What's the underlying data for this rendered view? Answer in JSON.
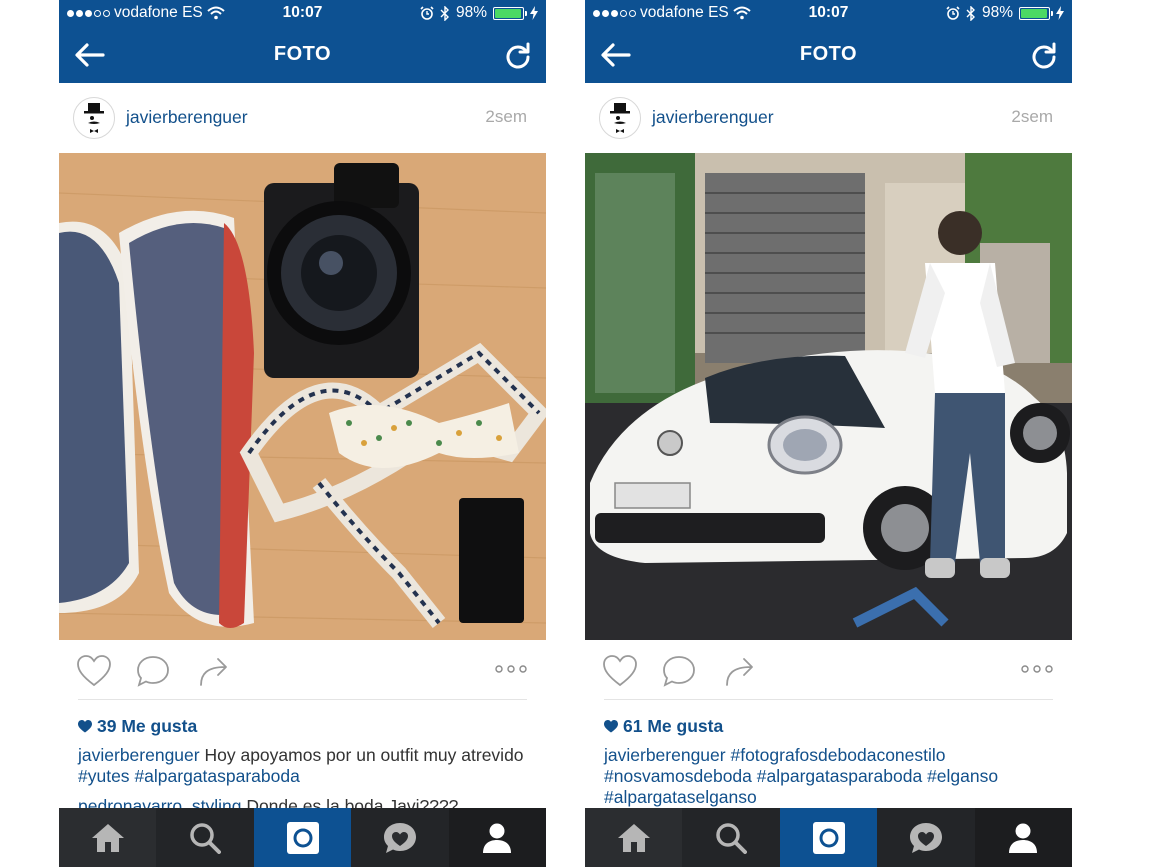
{
  "screens": [
    {
      "status": {
        "carrier": "vodafone ES",
        "time": "10:07",
        "battery": "98%"
      },
      "nav": {
        "title": "FOTO"
      },
      "post": {
        "username": "javierberenguer",
        "time_ago": "2sem",
        "likes": "39 Me gusta",
        "caption": {
          "user": "javierberenguer",
          "text": "Hoy apoyamos por un outfit muy atrevido",
          "tags": [
            "#yutes",
            "#alpargatasparaboda"
          ]
        },
        "comment": {
          "user": "pedronavarro_styling",
          "text": "Donde es la boda Javi????"
        }
      }
    },
    {
      "status": {
        "carrier": "vodafone ES",
        "time": "10:07",
        "battery": "98%"
      },
      "nav": {
        "title": "FOTO"
      },
      "post": {
        "username": "javierberenguer",
        "time_ago": "2sem",
        "likes": "61 Me gusta",
        "caption": {
          "user": "javierberenguer",
          "tags": [
            "#fotografosdebodaconestilo",
            "#nosvamosdeboda",
            "#alpargatasparaboda",
            "#elganso",
            "#alpargataselganso"
          ]
        }
      }
    }
  ],
  "icons": {
    "signal": "signal-dots-icon",
    "wifi": "wifi-icon",
    "alarm": "alarm-icon",
    "bluetooth": "bluetooth-icon",
    "battery": "battery-icon",
    "back": "back-arrow-icon",
    "refresh": "refresh-icon",
    "like": "heart-icon",
    "comment": "comment-bubble-icon",
    "share": "share-arrow-icon",
    "more": "more-dots-icon",
    "home": "home-icon",
    "explore": "search-icon",
    "camera": "camera-icon",
    "activity": "activity-heart-icon",
    "profile": "profile-icon"
  },
  "colors": {
    "brand": "#0d5192",
    "link": "#12508b",
    "battery_fill": "#4cd964",
    "tab_bar": "#2a2c2f"
  },
  "tab_bar": {
    "active": "camera"
  }
}
